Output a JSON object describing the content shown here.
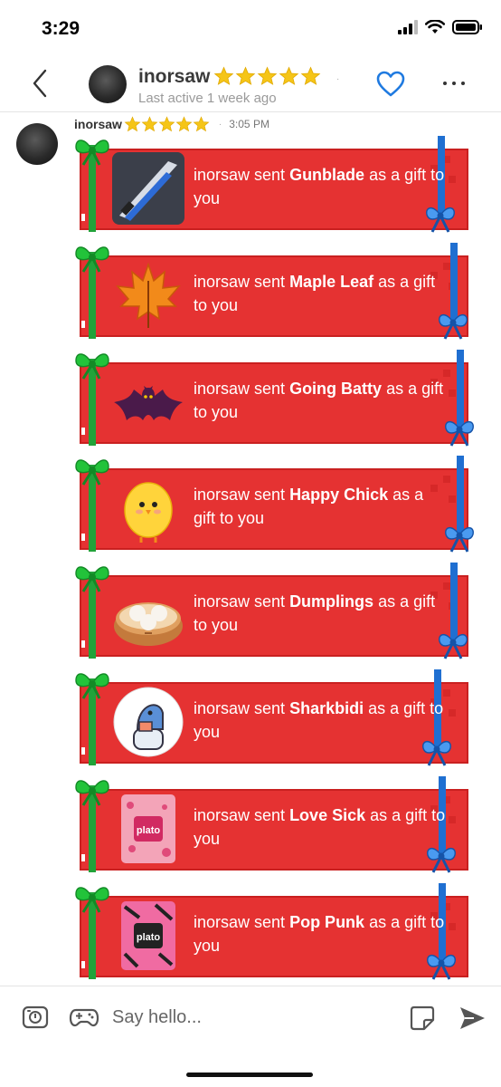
{
  "status_bar": {
    "time": "3:29"
  },
  "header": {
    "name": "inorsaw",
    "last_active": "Last active 1 week ago",
    "star_count": 5,
    "dot": "·"
  },
  "message": {
    "sender": "inorsaw",
    "sep": "·",
    "time": "3:05 PM",
    "star_count": 5
  },
  "gifts": [
    {
      "prefix": "inorsaw sent ",
      "name": "Gunblade",
      "suffix": " as a gift to you",
      "icon": "gunblade-icon"
    },
    {
      "prefix": "inorsaw sent ",
      "name": "Maple Leaf",
      "suffix": " as a gift to you",
      "icon": "maple-leaf-icon"
    },
    {
      "prefix": "inorsaw sent ",
      "name": "Going Batty",
      "suffix": " as a gift to you",
      "icon": "bat-icon"
    },
    {
      "prefix": "inorsaw sent ",
      "name": "Happy Chick",
      "suffix": " as a gift to you",
      "icon": "chick-icon"
    },
    {
      "prefix": "inorsaw sent ",
      "name": "Dumplings",
      "suffix": " as a gift to you",
      "icon": "dumplings-icon"
    },
    {
      "prefix": "inorsaw sent ",
      "name": "Sharkbidi",
      "suffix": " as a gift to you",
      "icon": "shark-icon"
    },
    {
      "prefix": "inorsaw sent ",
      "name": "Love Sick",
      "suffix": " as a gift to you",
      "icon": "plato-card-icon",
      "card_label": "plato"
    },
    {
      "prefix": "inorsaw sent ",
      "name": "Pop Punk",
      "suffix": " as a gift to you",
      "icon": "plato-card-icon",
      "card_label": "plato"
    }
  ],
  "composer": {
    "placeholder": "Say hello..."
  },
  "colors": {
    "gift_red": "#e53232",
    "ribbon_green": "#22a33a",
    "ribbon_blue": "#1f6fd1",
    "heart_blue": "#1f7ae0"
  }
}
